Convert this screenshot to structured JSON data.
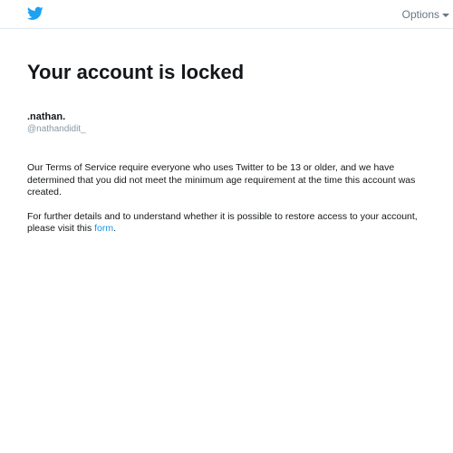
{
  "header": {
    "logo_icon": "twitter-bird-icon",
    "options_label": "Options",
    "brand_color": "#1da1f2"
  },
  "main": {
    "title": "Your account is locked",
    "display_name": ".nathan.",
    "handle": "@nathandidit_",
    "paragraph1": "Our Terms of Service require everyone who uses Twitter to be 13 or older, and we have determined that you did not meet the minimum age requirement at the time this account was created.",
    "paragraph2_text": "For further details and to understand whether it is possible to restore access to your account, please visit this ",
    "paragraph2_link": "form",
    "paragraph2_end": ".",
    "link_color": "#1b95e0"
  }
}
